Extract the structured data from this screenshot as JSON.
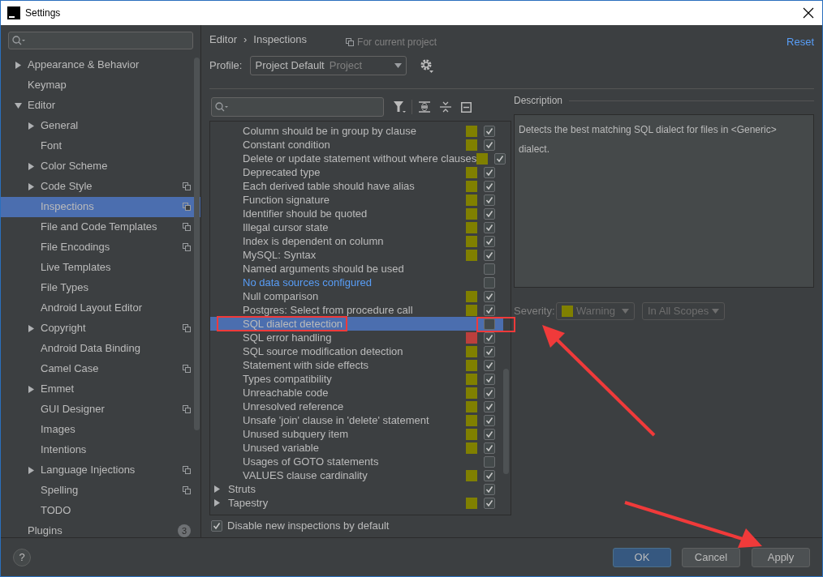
{
  "window": {
    "title": "Settings"
  },
  "sidebar": {
    "items": [
      {
        "label": "Appearance & Behavior",
        "expanded": false,
        "project_scope": false
      },
      {
        "label": "Keymap",
        "project_scope": false
      },
      {
        "label": "Editor",
        "expanded": true,
        "project_scope": false,
        "children": [
          {
            "label": "General",
            "expanded": false,
            "project_scope": false,
            "selected": false
          },
          {
            "label": "Font",
            "project_scope": false,
            "selected": false
          },
          {
            "label": "Color Scheme",
            "expanded": false,
            "project_scope": false,
            "selected": false
          },
          {
            "label": "Code Style",
            "expanded": false,
            "project_scope": true,
            "selected": false
          },
          {
            "label": "Inspections",
            "project_scope": true,
            "selected": true
          },
          {
            "label": "File and Code Templates",
            "project_scope": true,
            "selected": false
          },
          {
            "label": "File Encodings",
            "project_scope": true,
            "selected": false
          },
          {
            "label": "Live Templates",
            "project_scope": false,
            "selected": false
          },
          {
            "label": "File Types",
            "project_scope": false,
            "selected": false
          },
          {
            "label": "Android Layout Editor",
            "project_scope": false,
            "selected": false
          },
          {
            "label": "Copyright",
            "expanded": false,
            "project_scope": true,
            "selected": false
          },
          {
            "label": "Android Data Binding",
            "project_scope": false,
            "selected": false
          },
          {
            "label": "Camel Case",
            "project_scope": true,
            "selected": false
          },
          {
            "label": "Emmet",
            "expanded": false,
            "project_scope": false,
            "selected": false
          },
          {
            "label": "GUI Designer",
            "project_scope": true,
            "selected": false
          },
          {
            "label": "Images",
            "project_scope": false,
            "selected": false
          },
          {
            "label": "Intentions",
            "project_scope": false,
            "selected": false
          },
          {
            "label": "Language Injections",
            "expanded": false,
            "project_scope": true,
            "selected": false
          },
          {
            "label": "Spelling",
            "project_scope": true,
            "selected": false
          },
          {
            "label": "TODO",
            "project_scope": false,
            "selected": false
          }
        ]
      },
      {
        "label": "Plugins",
        "badge": "3",
        "project_scope": false
      }
    ]
  },
  "header": {
    "breadcrumb": [
      "Editor",
      "Inspections"
    ],
    "separator": "›",
    "scope_note": "For current project",
    "reset": "Reset"
  },
  "profile": {
    "label": "Profile:",
    "value": "Project Default",
    "scope": "Project"
  },
  "inspections": {
    "rows": [
      {
        "kind": "item",
        "label": "Column should be in group by clause",
        "color": "#808000",
        "checked": true,
        "selected": false
      },
      {
        "kind": "item",
        "label": "Constant condition",
        "color": "#808000",
        "checked": true,
        "selected": false
      },
      {
        "kind": "item",
        "label": "Delete or update statement without where clauses",
        "color": "#808000",
        "checked": true,
        "selected": false
      },
      {
        "kind": "item",
        "label": "Deprecated type",
        "color": "#808000",
        "checked": true,
        "selected": false
      },
      {
        "kind": "item",
        "label": "Each derived table should have alias",
        "color": "#808000",
        "checked": true,
        "selected": false
      },
      {
        "kind": "item",
        "label": "Function signature",
        "color": "#808000",
        "checked": true,
        "selected": false
      },
      {
        "kind": "item",
        "label": "Identifier should be quoted",
        "color": "#808000",
        "checked": true,
        "selected": false
      },
      {
        "kind": "item",
        "label": "Illegal cursor state",
        "color": "#808000",
        "checked": true,
        "selected": false
      },
      {
        "kind": "item",
        "label": "Index is dependent on column",
        "color": "#808000",
        "checked": true,
        "selected": false
      },
      {
        "kind": "item",
        "label": "MySQL: Syntax",
        "color": "#808000",
        "checked": true,
        "selected": false
      },
      {
        "kind": "item",
        "label": "Named arguments should be used",
        "checked": false,
        "selected": false
      },
      {
        "kind": "link",
        "label": "No data sources configured",
        "checked": false,
        "selected": false
      },
      {
        "kind": "item",
        "label": "Null comparison",
        "color": "#808000",
        "checked": true,
        "selected": false
      },
      {
        "kind": "item",
        "label": "Postgres: Select from procedure call",
        "color": "#808000",
        "checked": true,
        "selected": false
      },
      {
        "kind": "item",
        "label": "SQL dialect detection",
        "checked": false,
        "selected": true
      },
      {
        "kind": "item",
        "label": "SQL error handling",
        "color": "#bc3f3c",
        "checked": true,
        "selected": false
      },
      {
        "kind": "item",
        "label": "SQL source modification detection",
        "color": "#808000",
        "checked": true,
        "selected": false
      },
      {
        "kind": "item",
        "label": "Statement with side effects",
        "color": "#808000",
        "checked": true,
        "selected": false
      },
      {
        "kind": "item",
        "label": "Types compatibility",
        "color": "#808000",
        "checked": true,
        "selected": false
      },
      {
        "kind": "item",
        "label": "Unreachable code",
        "color": "#808000",
        "checked": true,
        "selected": false
      },
      {
        "kind": "item",
        "label": "Unresolved reference",
        "color": "#808000",
        "checked": true,
        "selected": false
      },
      {
        "kind": "item",
        "label": "Unsafe 'join' clause in 'delete' statement",
        "color": "#808000",
        "checked": true,
        "selected": false
      },
      {
        "kind": "item",
        "label": "Unused subquery item",
        "color": "#808000",
        "checked": true,
        "selected": false
      },
      {
        "kind": "item",
        "label": "Unused variable",
        "color": "#808000",
        "checked": true,
        "selected": false
      },
      {
        "kind": "item",
        "label": "Usages of GOTO statements",
        "checked": false,
        "selected": false
      },
      {
        "kind": "item",
        "label": "VALUES clause cardinality",
        "color": "#808000",
        "checked": true,
        "selected": false
      },
      {
        "kind": "group",
        "label": "Struts",
        "checked": true,
        "selected": false
      },
      {
        "kind": "group",
        "label": "Tapestry",
        "color": "#808000",
        "checked": true,
        "selected": false
      }
    ]
  },
  "disable_new": {
    "label": "Disable new inspections by default",
    "checked": true
  },
  "description": {
    "title": "Description",
    "text": "Detects the best matching SQL dialect for files in <Generic> dialect."
  },
  "severity": {
    "label": "Severity:",
    "value": "Warning",
    "color": "#808000",
    "scope": "In All Scopes"
  },
  "buttons": {
    "help": "?",
    "ok": "OK",
    "cancel": "Cancel",
    "apply": "Apply"
  }
}
